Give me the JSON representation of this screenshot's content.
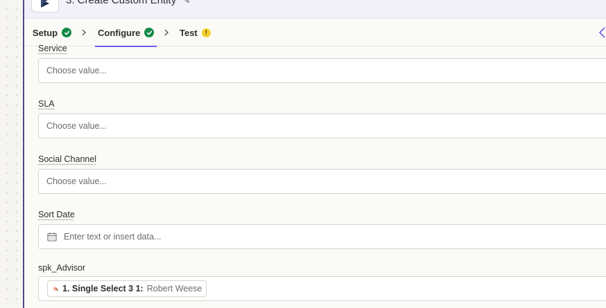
{
  "header": {
    "step_title": "3. Create Custom Entity",
    "app_logo_icon": "dynamics-logo-icon",
    "edit_icon": "pencil-icon"
  },
  "tabs": [
    {
      "label": "Setup",
      "status": "complete",
      "status_icon": "check-circle-icon"
    },
    {
      "label": "Configure",
      "status": "complete",
      "status_icon": "check-circle-icon",
      "active": true
    },
    {
      "label": "Test",
      "status": "warning",
      "status_icon": "warning-circle-icon",
      "status_glyph": "!"
    }
  ],
  "header_right_icon": "sparkle-icon",
  "fields": [
    {
      "label": "Service",
      "placeholder": "Choose value..."
    },
    {
      "label": "SLA",
      "placeholder": "Choose value..."
    },
    {
      "label": "Social Channel",
      "placeholder": "Choose value..."
    },
    {
      "label": "Sort Date",
      "placeholder": "Enter text or insert data...",
      "icon": "calendar-icon"
    },
    {
      "label": "spk_Advisor",
      "pill": {
        "name": "1. Single Select 3 1:",
        "value": "Robert Weese",
        "icon": "app-logo-icon"
      }
    }
  ],
  "colors": {
    "accent": "#695be8",
    "check": "#138a46",
    "warning": "#f2d22e",
    "panel_border": "#4f4a86"
  }
}
